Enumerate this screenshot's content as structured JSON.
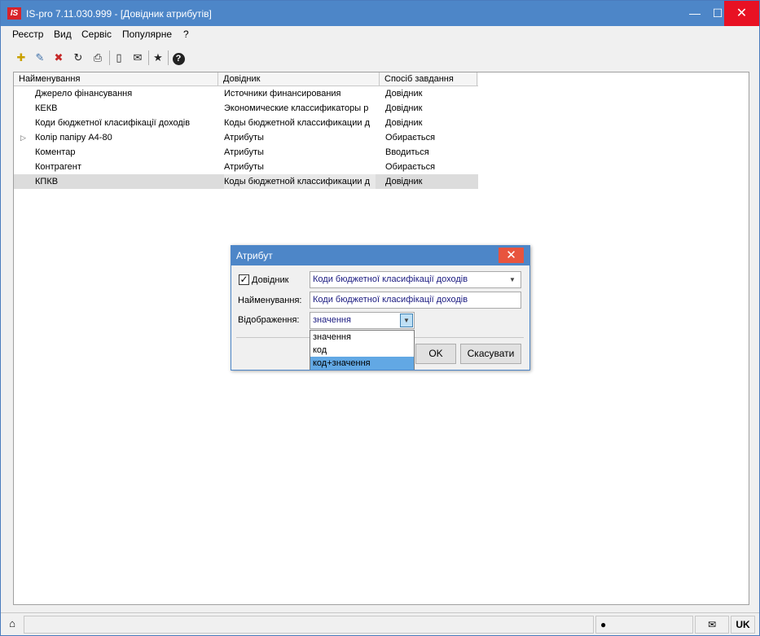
{
  "window": {
    "app_logo": "IS",
    "title": "IS-pro 7.11.030.999 - [Довідник атрибутів]",
    "minimize_icon": "minimize-icon",
    "maximize_icon": "maximize-icon",
    "close_icon": "close-icon"
  },
  "menu": {
    "items": [
      "Реєстр",
      "Вид",
      "Сервіс",
      "Популярне",
      "?"
    ]
  },
  "toolbar": {
    "buttons": [
      {
        "icon": "new-icon",
        "glyph": "✚"
      },
      {
        "icon": "edit-icon",
        "glyph": "✎"
      },
      {
        "icon": "delete-icon",
        "glyph": "✖"
      },
      {
        "icon": "refresh-icon",
        "glyph": "↻"
      },
      {
        "icon": "print-icon",
        "glyph": "⎙"
      },
      {
        "icon": "document-icon",
        "glyph": "▯"
      },
      {
        "icon": "mail-icon",
        "glyph": "✉"
      },
      {
        "icon": "favorite-star-icon",
        "glyph": "★"
      },
      {
        "icon": "help-icon",
        "glyph": "?"
      }
    ]
  },
  "grid": {
    "columns": [
      "Найменування",
      "Довідник",
      "Спосіб завдання"
    ],
    "rows": [
      {
        "name": "Джерело фінансування",
        "reference": "Источники финансирования",
        "mode": "Довідник",
        "expandable": false,
        "selected": false
      },
      {
        "name": "КЕКВ",
        "reference": "Экономические классификаторы р",
        "mode": "Довідник",
        "expandable": false,
        "selected": false
      },
      {
        "name": "Коди бюджетної класифікації доходів",
        "reference": "Коды бюджетной классификации д",
        "mode": "Довідник",
        "expandable": false,
        "selected": false
      },
      {
        "name": "Колір папіру А4-80",
        "reference": "Атрибуты",
        "mode": "Обирається",
        "expandable": true,
        "selected": false
      },
      {
        "name": "Коментар",
        "reference": "Атрибуты",
        "mode": "Вводиться",
        "expandable": false,
        "selected": false
      },
      {
        "name": "Контрагент",
        "reference": "Атрибуты",
        "mode": "Обирається",
        "expandable": false,
        "selected": false
      },
      {
        "name": "КПКВ",
        "reference": "Коды бюджетной классификации д",
        "mode": "Довідник",
        "expandable": false,
        "selected": true
      }
    ]
  },
  "dialog": {
    "title": "Атрибут",
    "checkbox_label": "Довідник",
    "checkbox_checked": true,
    "reference_value": "Коди бюджетної класифікації доходів",
    "name_label": "Найменування:",
    "name_value": "Коди бюджетної класифікації доходів",
    "display_label": "Відображення:",
    "display_value": "значення",
    "display_options": [
      "значення",
      "код",
      "код+значення"
    ],
    "highlighted_option": "код+значення",
    "ok_label": "OK",
    "cancel_label": "Скасувати"
  },
  "statusbar": {
    "left_icon": "factory-icon",
    "user_icon": "user-icon",
    "mail_icon": "mail-icon",
    "language": "UK"
  }
}
